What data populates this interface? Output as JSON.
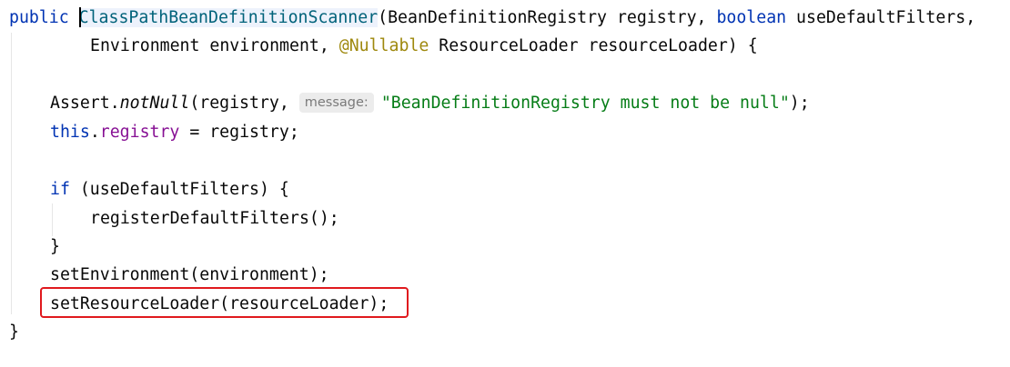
{
  "code": {
    "line1": {
      "kw_public": "public",
      "class_name": "ClassPathBeanDefinitionScanner",
      "p1": "(BeanDefinitionRegistry registry, ",
      "kw_boolean": "boolean",
      "p2": " useDefaultFilters,"
    },
    "line2": {
      "p1": "Environment environment, ",
      "annotation": "@Nullable",
      "p2": " ResourceLoader resourceLoader) {"
    },
    "line4": {
      "p1": "Assert.",
      "method": "notNull",
      "p2": "(registry, ",
      "hint": "message:",
      "string": "\"BeanDefinitionRegistry must not be null\"",
      "p3": ");"
    },
    "line5": {
      "kw_this": "this",
      "dot": ".",
      "field": "registry",
      "p1": " = registry;"
    },
    "line7": {
      "kw_if": "if",
      "p1": " (useDefaultFilters) {"
    },
    "line8": "registerDefaultFilters();",
    "line9": "}",
    "line10": "setEnvironment(environment);",
    "line11": "setResourceLoader(resourceLoader);",
    "line12": "}"
  },
  "colors": {
    "keyword": "#0033b3",
    "class_name": "#00627a",
    "annotation": "#9e880d",
    "field": "#871094",
    "string": "#067d17",
    "highlight_border": "#e0191e"
  }
}
